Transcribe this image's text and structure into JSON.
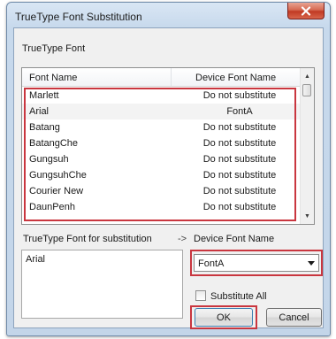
{
  "window": {
    "title": "TrueType Font Substitution"
  },
  "list": {
    "group_label": "TrueType Font",
    "columns": [
      "Font Name",
      "Device Font Name"
    ],
    "rows": [
      {
        "font": "Marlett",
        "device": "Do not substitute"
      },
      {
        "font": "Arial",
        "device": "FontA"
      },
      {
        "font": "Batang",
        "device": "Do not substitute"
      },
      {
        "font": "BatangChe",
        "device": "Do not substitute"
      },
      {
        "font": "Gungsuh",
        "device": "Do not substitute"
      },
      {
        "font": "GungsuhChe",
        "device": "Do not substitute"
      },
      {
        "font": "Courier New",
        "device": "Do not substitute"
      },
      {
        "font": "DaunPenh",
        "device": "Do not substitute"
      }
    ]
  },
  "substitution": {
    "label": "TrueType Font for substitution",
    "arrow": "->",
    "device_label": "Device Font Name",
    "selected_font": "Arial",
    "device_value": "FontA",
    "substitute_all_label": "Substitute All"
  },
  "buttons": {
    "ok": "OK",
    "cancel": "Cancel"
  },
  "colors": {
    "highlight": "#c9363f",
    "title_bar": "#c7d9ec",
    "close": "#c03a23"
  }
}
